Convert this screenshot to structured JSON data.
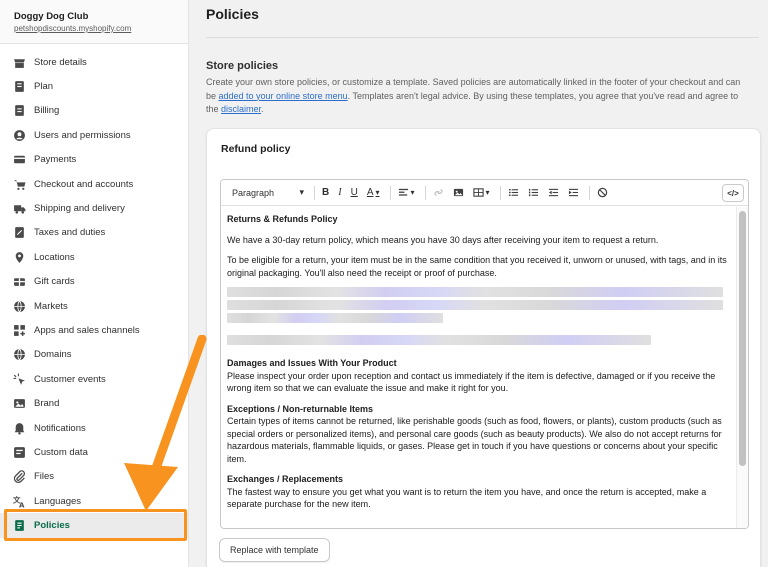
{
  "store": {
    "name": "Doggy Dog Club",
    "url": "petshopdiscounts.myshopify.com"
  },
  "sidebar": {
    "items": [
      {
        "label": "Store details",
        "icon": "store-icon"
      },
      {
        "label": "Plan",
        "icon": "plan-icon"
      },
      {
        "label": "Billing",
        "icon": "billing-icon"
      },
      {
        "label": "Users and permissions",
        "icon": "user-icon"
      },
      {
        "label": "Payments",
        "icon": "payments-icon"
      },
      {
        "label": "Checkout and accounts",
        "icon": "cart-icon"
      },
      {
        "label": "Shipping and delivery",
        "icon": "truck-icon"
      },
      {
        "label": "Taxes and duties",
        "icon": "tax-icon"
      },
      {
        "label": "Locations",
        "icon": "location-pin-icon"
      },
      {
        "label": "Gift cards",
        "icon": "gift-card-icon"
      },
      {
        "label": "Markets",
        "icon": "globe-icon"
      },
      {
        "label": "Apps and sales channels",
        "icon": "apps-icon"
      },
      {
        "label": "Domains",
        "icon": "domain-globe-icon"
      },
      {
        "label": "Customer events",
        "icon": "customer-events-icon"
      },
      {
        "label": "Brand",
        "icon": "brand-icon"
      },
      {
        "label": "Notifications",
        "icon": "bell-icon"
      },
      {
        "label": "Custom data",
        "icon": "custom-data-icon"
      },
      {
        "label": "Files",
        "icon": "paperclip-icon"
      },
      {
        "label": "Languages",
        "icon": "language-icon"
      },
      {
        "label": "Policies",
        "icon": "policy-icon",
        "active": true
      }
    ]
  },
  "page": {
    "title": "Policies",
    "section_title": "Store policies",
    "desc_1": "Create your own store policies, or customize a template. Saved policies are automatically linked in the footer of your checkout and can be ",
    "desc_link_1": "added to your online store menu",
    "desc_2": ". Templates aren't legal advice. By using these templates, you agree that you've read and agree to the ",
    "desc_link_2": "disclaimer",
    "desc_3": "."
  },
  "card": {
    "title": "Refund policy",
    "toolbar": {
      "paragraph": "Paragraph",
      "bold": "B",
      "italic": "I",
      "underline": "U",
      "text_color": "A",
      "code": "</>"
    },
    "content": {
      "h1": "Returns & Refunds Policy",
      "p1": "We have a 30-day return policy, which means you have 30 days after receiving your item to request a return.",
      "p2": "To be eligible for a return, your item must be in the same condition that you received it, unworn or unused, with tags, and in its original packaging. You'll also need the receipt or proof of purchase.",
      "h2": "Damages and Issues With Your Product",
      "p3": "Please inspect your order upon reception and contact us immediately if the item is defective, damaged or if you receive the wrong item so that we can evaluate the issue and make it right for you.",
      "h3": "Exceptions / Non-returnable Items",
      "p4": "Certain types of items cannot be returned, like perishable goods (such as food, flowers, or plants), custom products (such as special orders or personalized items), and personal care goods (such as beauty products). We also do not accept returns for hazardous materials, flammable liquids, or gases. Please get in touch if you have questions or concerns about your specific item.",
      "h4": "Exchanges / Replacements",
      "p5": "The fastest way to ensure you get what you want is to return the item you have, and once the return is accepted, make a separate purchase for the new item."
    },
    "replace_button": "Replace with template"
  },
  "colors": {
    "accent": "#0a6b4a",
    "highlight": "#f7931e",
    "link": "#2c6ecb"
  }
}
